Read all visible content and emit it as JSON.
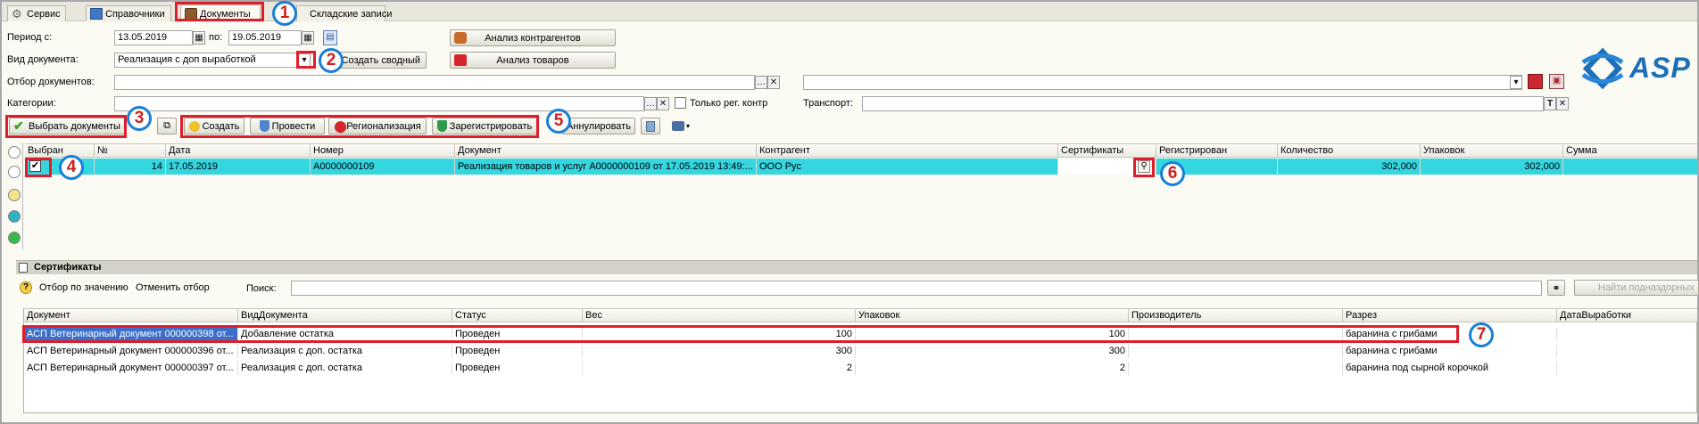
{
  "tabs": [
    {
      "label": "Сервис",
      "icon": "gear-icon"
    },
    {
      "label": "Справочники",
      "icon": "book-icon"
    },
    {
      "label": "Документы",
      "icon": "briefcase-icon"
    },
    {
      "label": "Складские записи",
      "icon": ""
    }
  ],
  "filters": {
    "period_label": "Период с:",
    "period_from": "13.05.2019",
    "period_to_label": "по:",
    "period_to": "19.05.2019",
    "doc_type_label": "Вид документа:",
    "doc_type_value": "Реализация с доп выработкой",
    "create_summary_label": "Создать сводный",
    "selection_label": "Отбор документов:",
    "categories_label": "Категории:",
    "only_reg_label": "Только рег. контр",
    "transport_label": "Транспорт:",
    "analysis_contractors": "Анализ контрагентов",
    "analysis_goods": "Анализ товаров"
  },
  "brand": {
    "text": "ASP",
    "color": "#1c6fb8"
  },
  "toolbar": {
    "select_docs": "Выбрать документы",
    "create": "Создать",
    "post": "Провести",
    "regionalization": "Регионализация",
    "register": "Зарегистрировать",
    "cancel": "Аннулировать"
  },
  "docs_table": {
    "columns": [
      "Выбран",
      "№",
      "Дата",
      "Номер",
      "Документ",
      "Контрагент",
      "Сертификаты",
      "Регистрирован",
      "Количество",
      "Упаковок",
      "Сумма"
    ],
    "rows": [
      {
        "checked": true,
        "num": "14",
        "date": "17.05.2019",
        "number": "A0000000109",
        "document": "Реализация товаров и услуг A0000000109 от 17.05.2019 13:49:...",
        "contractor": "ООО Рус",
        "certificates": "",
        "registered": "",
        "quantity": "302,000",
        "packages": "302,000",
        "sum": ""
      }
    ]
  },
  "certs_panel": {
    "title": "Сертификаты",
    "filter_by_value": "Отбор по значению",
    "cancel_filter": "Отменить отбор",
    "search_label": "Поиск:",
    "find_substrings": "Найти подназдорных",
    "columns": [
      "Документ",
      "ВидДокумента",
      "Статус",
      "Вес",
      "Упаковок",
      "Производитель",
      "Разрез",
      "ДатаВыработки"
    ],
    "rows": [
      {
        "document": "АСП Ветеринарный документ 000000398 от...",
        "kind": "Добавление остатка",
        "status": "Проведен",
        "weight": "100",
        "packages": "100",
        "producer": "",
        "section": "баранина с грибами",
        "date": ""
      },
      {
        "document": "АСП Ветеринарный документ 000000396 от...",
        "kind": "Реализация с доп. остатка",
        "status": "Проведен",
        "weight": "300",
        "packages": "300",
        "producer": "",
        "section": "баранина с грибами",
        "date": ""
      },
      {
        "document": "АСП Ветеринарный документ 000000397 от...",
        "kind": "Реализация с доп. остатка",
        "status": "Проведен",
        "weight": "2",
        "packages": "2",
        "producer": "",
        "section": "баранина под сырной корочкой",
        "date": ""
      }
    ]
  },
  "annotations": [
    "1",
    "2",
    "3",
    "4",
    "5",
    "6",
    "7"
  ],
  "colors": {
    "highlight_row": "#34d6e0",
    "annotation_red": "#e01e2b",
    "annotation_blue": "#1a7fd6",
    "selected_cell": "#3d6fc7"
  }
}
